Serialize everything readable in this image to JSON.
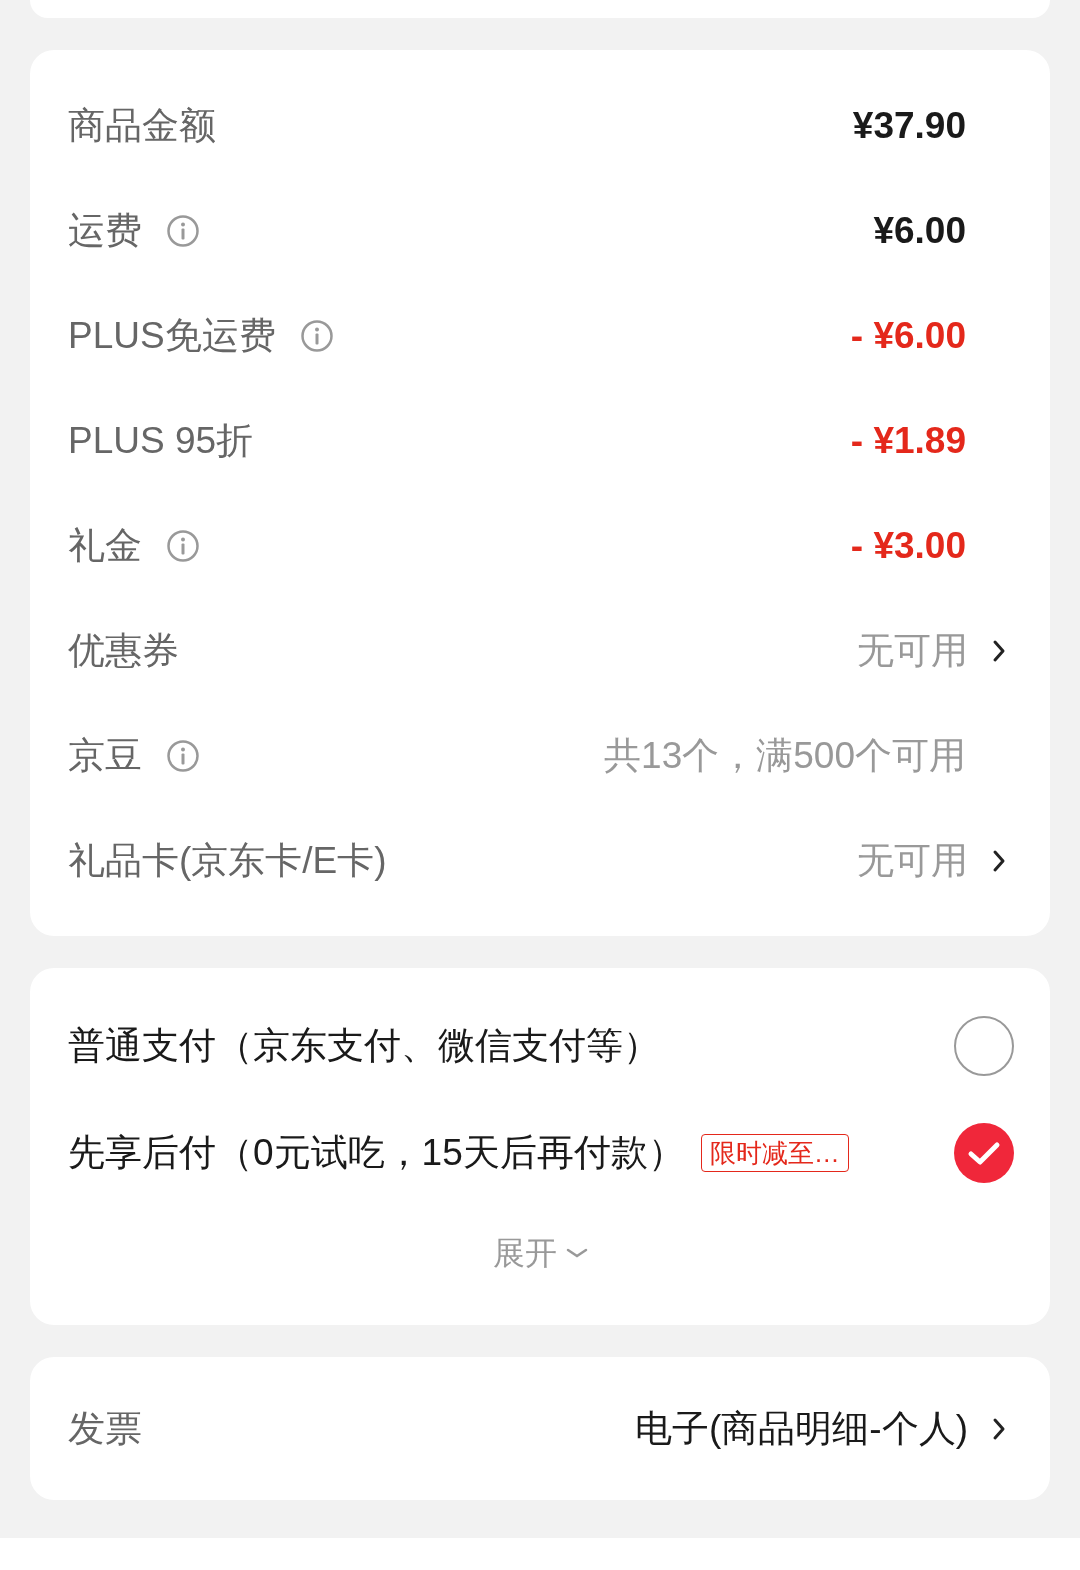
{
  "fees": [
    {
      "label": "商品金额",
      "info": false,
      "kind": "amount",
      "value": "¥37.90"
    },
    {
      "label": "运费",
      "info": true,
      "kind": "amount",
      "value": "¥6.00"
    },
    {
      "label": "PLUS免运费",
      "info": true,
      "kind": "discount",
      "value": "- ¥6.00"
    },
    {
      "label": "PLUS 95折",
      "info": false,
      "kind": "discount",
      "value": "- ¥1.89"
    },
    {
      "label": "礼金",
      "info": true,
      "kind": "discount",
      "value": "- ¥3.00"
    },
    {
      "label": "优惠券",
      "info": false,
      "kind": "option",
      "value": "无可用"
    },
    {
      "label": "京豆",
      "info": true,
      "kind": "note",
      "value": "共13个，满500个可用"
    },
    {
      "label": "礼品卡(京东卡/E卡)",
      "info": false,
      "kind": "option",
      "value": "无可用"
    }
  ],
  "payment_methods": [
    {
      "label": "普通支付（京东支付、微信支付等）",
      "selected": false
    },
    {
      "label": "先享后付（0元试吃，15天后再付款）",
      "badge": "限时减至…",
      "selected": true
    }
  ],
  "expand": "展开",
  "invoice": {
    "label": "发票",
    "value": "电子(商品明细-个人)"
  }
}
